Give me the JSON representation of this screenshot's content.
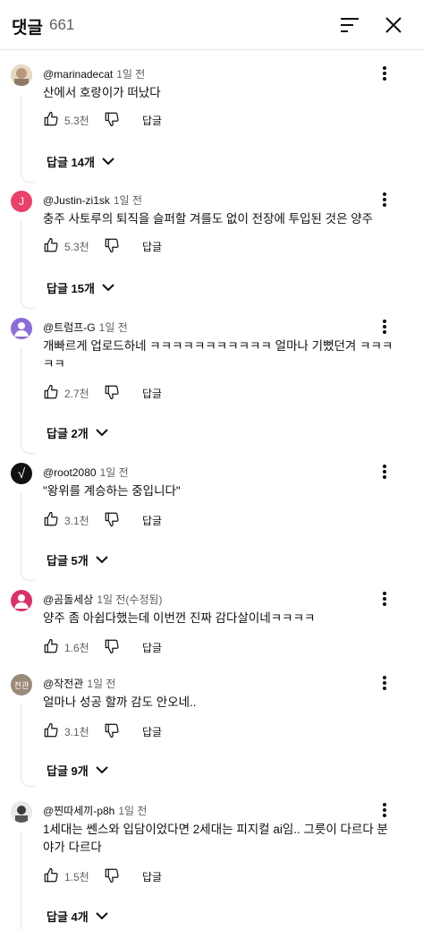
{
  "header": {
    "title": "댓글",
    "count": "661"
  },
  "comments": [
    {
      "author": "@marinadecat",
      "time": "1일 전",
      "text": "산에서 호랑이가 떠났다",
      "likes": "5.3천",
      "reply_label": "답글",
      "replies_label": "답글 14개",
      "avatar_color": "#c8b8a0"
    },
    {
      "author": "@Justin-zi1sk",
      "time": "1일 전",
      "text": "충주 사토루의 퇴직을 슬퍼할 겨를도 없이 전장에 투입된 것은 양주",
      "likes": "5.3천",
      "reply_label": "답글",
      "replies_label": "답글 15개",
      "avatar_letter": "J",
      "avatar_color": "#e8416a"
    },
    {
      "author": "@트럼프-G",
      "time": "1일 전",
      "text": "개빠르게 업로드하네 ㅋㅋㅋㅋㅋㅋㅋㅋㅋㅋㅋ 얼마나 기뻤던겨 ㅋㅋㅋㅋㅋ",
      "likes": "2.7천",
      "reply_label": "답글",
      "replies_label": "답글 2개",
      "avatar_color": "#8b6dd6"
    },
    {
      "author": "@root2080",
      "time": "1일 전",
      "text": "\"왕위를 계승하는 중입니다\"",
      "likes": "3.1천",
      "reply_label": "답글",
      "replies_label": "답글 5개",
      "avatar_letter": "√",
      "avatar_color": "#111111"
    },
    {
      "author": "@곰돌세상",
      "time": "1일 전(수정됨)",
      "text": "양주 좀 아쉽다했는데 이번껀 진짜 감다살이네ㅋㅋㅋㅋ",
      "likes": "1.6천",
      "reply_label": "답글",
      "avatar_color": "#d6336c"
    },
    {
      "author": "@작전관",
      "time": "1일 전",
      "text": "얼마나 성공 할까 감도 안오네..",
      "likes": "3.1천",
      "reply_label": "답글",
      "replies_label": "답글 9개",
      "avatar_letter": "전관",
      "avatar_color": "#9c8a7a"
    },
    {
      "author": "@찐따세끼-p8h",
      "time": "1일 전",
      "text": "1세대는 쎈스와 입담이었다면 2세대는 피지컬 ai임.. 그릇이 다르다 분야가 다르다",
      "likes": "1.5천",
      "reply_label": "답글",
      "replies_label": "답글 4개",
      "avatar_color": "#5a5a5a"
    }
  ]
}
